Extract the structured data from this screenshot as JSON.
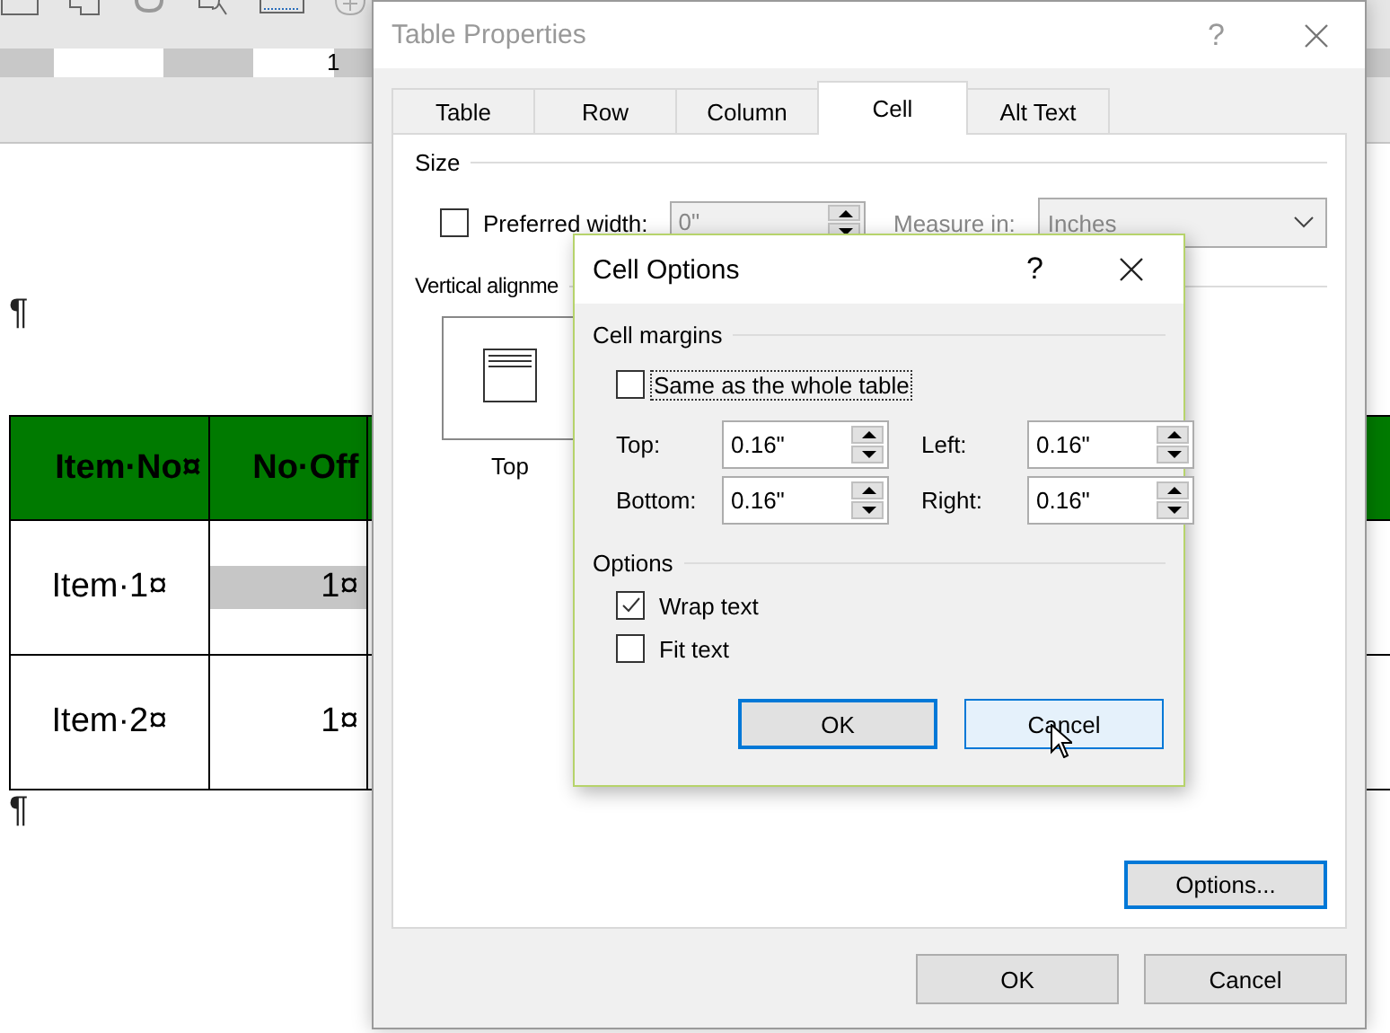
{
  "document": {
    "ruler_label": "1",
    "paragraph_marks": [
      "¶",
      "¶"
    ],
    "table": {
      "columns": [
        "Item·No¤",
        "No·Off"
      ],
      "rows": [
        {
          "cells": [
            {
              "text": "Item·1¤",
              "selected": false
            },
            {
              "text": "1¤",
              "selected": true
            }
          ]
        },
        {
          "cells": [
            {
              "text": "Item·2¤",
              "selected": false
            },
            {
              "text": "1¤",
              "selected": false
            }
          ]
        }
      ]
    }
  },
  "table_properties": {
    "title": "Table Properties",
    "help": "?",
    "tabs": [
      {
        "label": "Table",
        "selected": false
      },
      {
        "label": "Row",
        "selected": false
      },
      {
        "label": "Column",
        "selected": false
      },
      {
        "label": "Cell",
        "selected": true
      },
      {
        "label": "Alt Text",
        "selected": false
      }
    ],
    "size": {
      "heading": "Size",
      "preferred_width": {
        "label": "Preferred width:",
        "checked": false,
        "value": "0\"",
        "disabled": true
      },
      "measure_in": {
        "label": "Measure in:",
        "value": "Inches",
        "disabled": true
      }
    },
    "vertical_alignment": {
      "heading": "Vertical alignme",
      "options": [
        {
          "label": "Top",
          "kind": "top"
        }
      ]
    },
    "options_button": "Options...",
    "buttons": [
      "OK",
      "Cancel"
    ]
  },
  "cell_options": {
    "title": "Cell Options",
    "help": "?",
    "margins_heading": "Cell margins",
    "same_as_table": {
      "label": "Same as the whole table",
      "checked": false
    },
    "margins": [
      {
        "label": "Top:",
        "value": "0.16\""
      },
      {
        "label": "Left:",
        "value": "0.16\""
      },
      {
        "label": "Bottom:",
        "value": "0.16\""
      },
      {
        "label": "Right:",
        "value": "0.16\""
      }
    ],
    "options_heading": "Options",
    "options": [
      {
        "label": "Wrap text",
        "checked": true
      },
      {
        "label": "Fit text",
        "checked": false
      }
    ],
    "buttons": [
      {
        "label": "OK",
        "kind": "default"
      },
      {
        "label": "Cancel",
        "kind": "hover"
      }
    ]
  }
}
